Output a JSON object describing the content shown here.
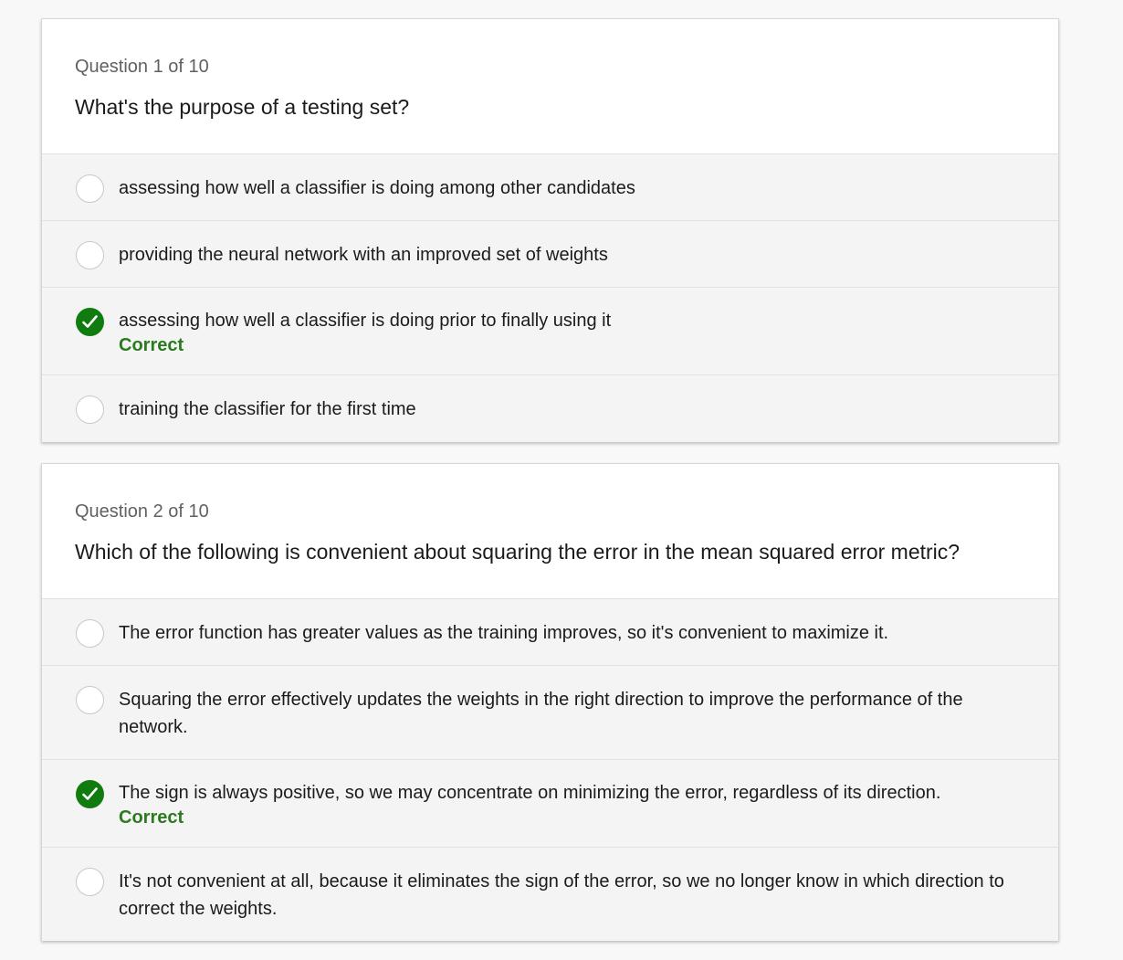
{
  "questions": [
    {
      "counter": "Question 1 of 10",
      "text": "What's the purpose of a testing set?",
      "options": [
        {
          "label": "assessing how well a classifier is doing among other candidates",
          "selected": false
        },
        {
          "label": "providing the neural network with an improved set of weights",
          "selected": false
        },
        {
          "label": "assessing how well a classifier is doing prior to finally using it",
          "selected": true,
          "feedback": "Correct"
        },
        {
          "label": "training the classifier for the first time",
          "selected": false
        }
      ]
    },
    {
      "counter": "Question 2 of 10",
      "text": "Which of the following is convenient about squaring the error in the mean squared error metric?",
      "options": [
        {
          "label": "The error function has greater values as the training improves, so it's convenient to maximize it.",
          "selected": false
        },
        {
          "label": "Squaring the error effectively updates the weights in the right direction to improve the performance of the network.",
          "selected": false
        },
        {
          "label": "The sign is always positive, so we may concentrate on minimizing the error, regardless of its direction.",
          "selected": true,
          "feedback": "Correct"
        },
        {
          "label": "It's not convenient at all, because it eliminates the sign of the error, so we no longer know in which direction to correct the weights.",
          "selected": false
        }
      ]
    }
  ],
  "colors": {
    "correct": "#107c10",
    "correct_text": "#2c7a1f",
    "option_bg": "#f4f4f4"
  },
  "icons": {
    "selected_marker": "checkmark-circle-icon",
    "unselected_marker": "radio-circle-icon"
  }
}
